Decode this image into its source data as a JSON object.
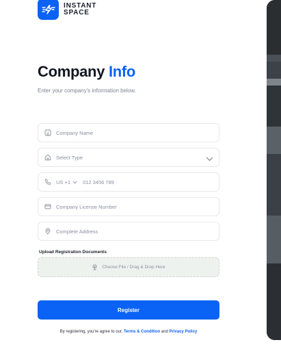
{
  "brand": {
    "line1": "INSTANT",
    "line2": "SPACE",
    "color": "#0b63f6"
  },
  "header": {
    "title_main": "Company",
    "title_accent": "Info",
    "subtitle": "Enter your company's information below."
  },
  "form": {
    "company_name": {
      "placeholder": "Company Name",
      "icon": "building-icon"
    },
    "type": {
      "placeholder": "Select Type",
      "icon": "home-icon"
    },
    "phone": {
      "country_code": "US +1",
      "placeholder": "012 3456 789",
      "icon": "phone-icon"
    },
    "license": {
      "placeholder": "Company License Number",
      "icon": "id-card-icon"
    },
    "address": {
      "placeholder": "Complete Address",
      "icon": "location-pin-icon"
    }
  },
  "upload": {
    "label": "Upload Registration Documents",
    "prompt": "Choose File / Drag & Drop Here",
    "icon": "upload-icon"
  },
  "actions": {
    "register_label": "Register"
  },
  "terms": {
    "prefix": "By registering, you're agree to our,",
    "terms_link": "Terms & Condition",
    "and": "and",
    "privacy_link": "Privacy Policy"
  }
}
